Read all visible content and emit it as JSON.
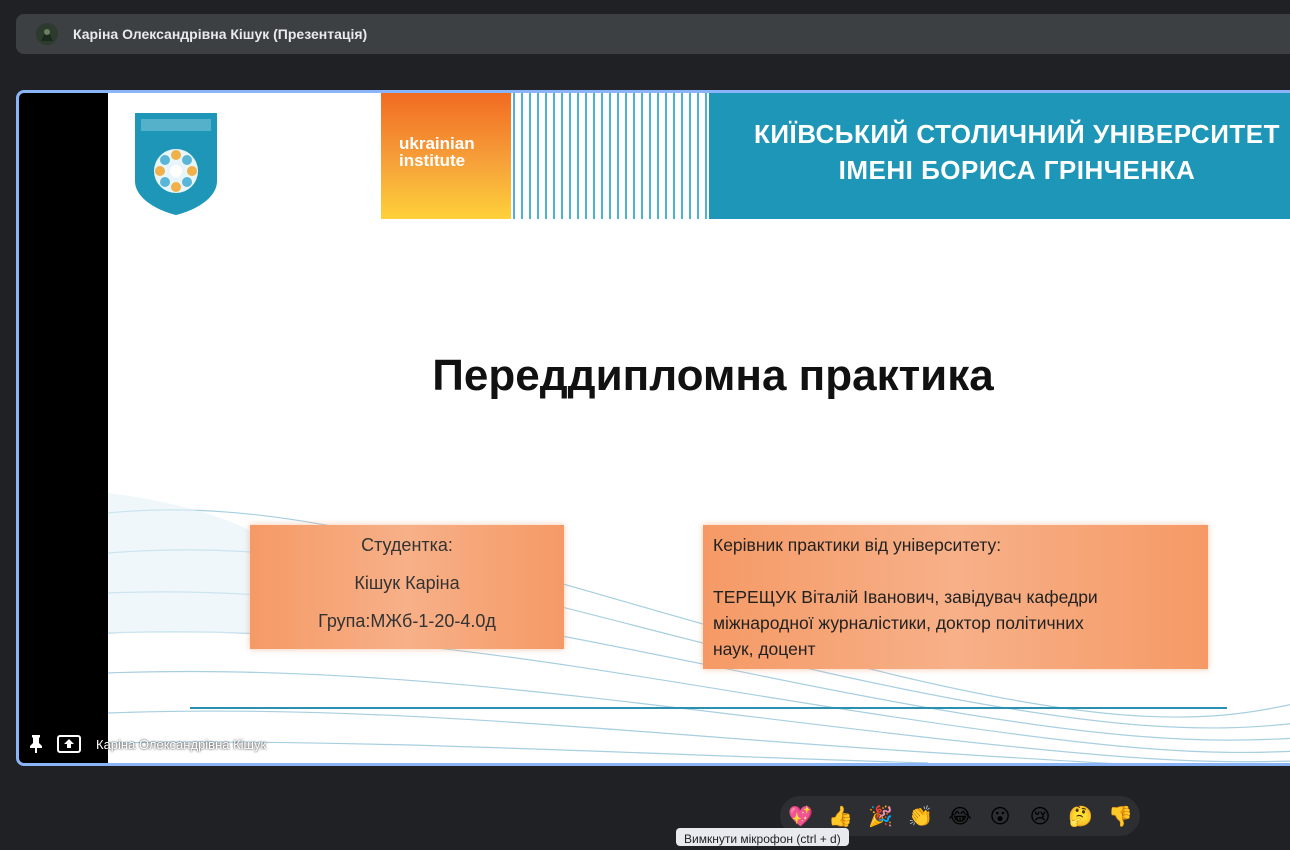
{
  "window": {
    "title": "Каріна Олександрівна Кішук (Презентація)"
  },
  "slide": {
    "brand_logo_line1": "ukrainian",
    "brand_logo_line2": "institute",
    "university_line1": "КИЇВСЬКИЙ СТОЛИЧНИЙ УНІВЕРСИТЕТ",
    "university_line2": "ІМЕНІ БОРИСА ГРІНЧЕНКА",
    "title": "Переддипломна практика",
    "student": {
      "label": "Студентка:",
      "name": "Кішук Каріна",
      "group": "Група:МЖб-1-20-4.0д"
    },
    "supervisor": {
      "label": "Керівник практики від університету:",
      "line1": "ТЕРЕЩУК Віталій Іванович, завідувач кафедри",
      "line2": "міжнародної журналістики, доктор політичних",
      "line3": "наук, доцент"
    }
  },
  "presenter": {
    "name": "Каріна Олександрівна Кішук"
  },
  "reactions": [
    "💖",
    "👍",
    "🎉",
    "👏",
    "😂",
    "😮",
    "😢",
    "🤔",
    "👎"
  ],
  "tooltip": "Вимкнути мікрофон (ctrl + d)",
  "colors": {
    "accent": "#8ab4f8",
    "banner": "#1d96b7",
    "box": "#f7a77a"
  }
}
